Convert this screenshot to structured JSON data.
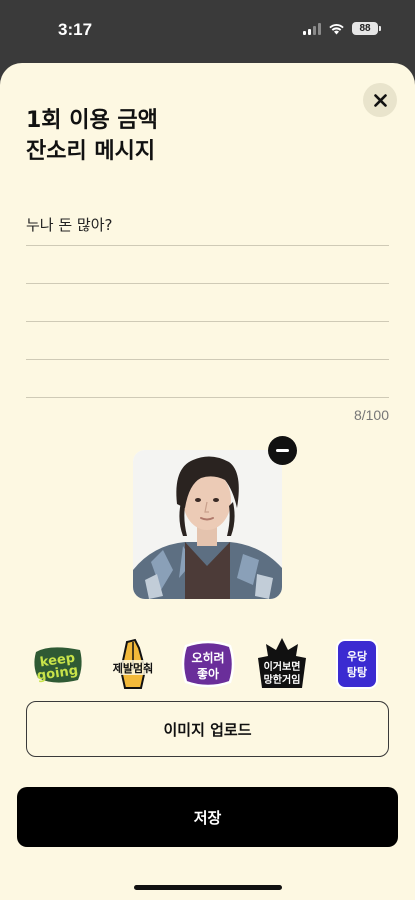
{
  "status": {
    "time": "3:17",
    "battery": "88"
  },
  "sheet": {
    "title_line1": "1회 이용 금액",
    "title_line2": "잔소리 메시지",
    "message_lines": [
      "누나 돈 많아?",
      "",
      "",
      "",
      ""
    ],
    "char_count": "8/100",
    "stickers": [
      {
        "name": "keep-going-sticker",
        "text_lines": [
          "keep",
          "going"
        ]
      },
      {
        "name": "please-sticker",
        "text_lines": [
          "제발멈춰"
        ]
      },
      {
        "name": "rather-good-sticker",
        "text_lines": [
          "오히려",
          "좋아"
        ]
      },
      {
        "name": "ruined-sticker",
        "text_lines": [
          "이거보면",
          "망한거임"
        ]
      },
      {
        "name": "pattern-sticker",
        "text_lines": [
          "우당",
          "탕탕"
        ]
      }
    ],
    "upload_label": "이미지 업로드",
    "save_label": "저장"
  },
  "colors": {
    "sheet_bg": "#fdf8e2",
    "primary": "#000000",
    "line": "#cfcab6"
  }
}
